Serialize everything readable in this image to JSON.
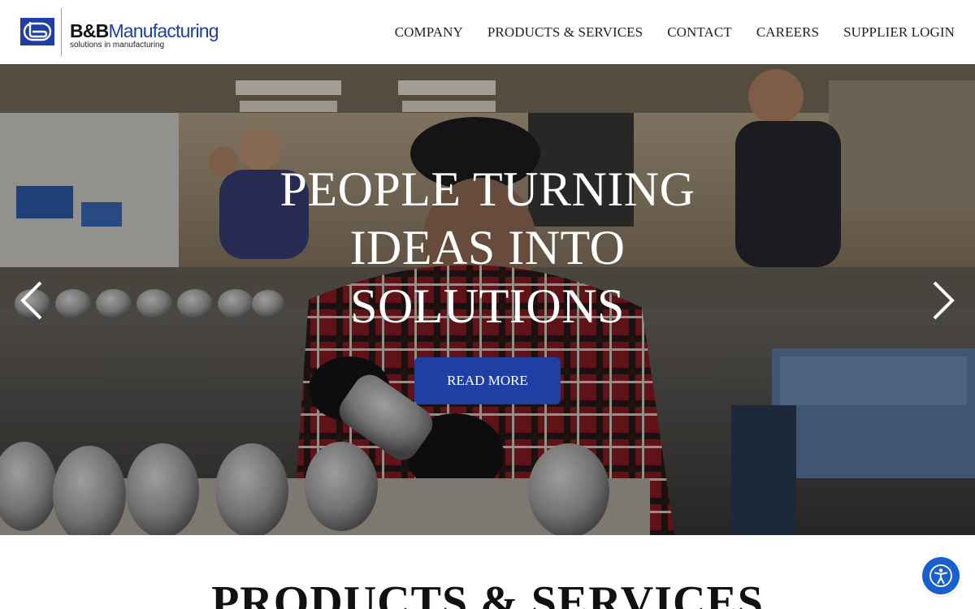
{
  "brand": {
    "name_bold": "B&B",
    "name_regular": "Manufacturing",
    "tagline": "solutions in manufacturing",
    "primary_color": "#1f3fa5"
  },
  "nav": {
    "items": [
      {
        "label": "COMPANY"
      },
      {
        "label": "PRODUCTS & SERVICES"
      },
      {
        "label": "CONTACT"
      },
      {
        "label": "CAREERS"
      },
      {
        "label": "SUPPLIER LOGIN"
      }
    ]
  },
  "hero": {
    "headline_lines": [
      "PEOPLE TURNING",
      "IDEAS INTO",
      "SOLUTIONS"
    ],
    "cta_label": "READ MORE",
    "cta_color": "#1f3fa5",
    "prev_icon": "chevron-left-icon",
    "next_icon": "chevron-right-icon"
  },
  "section": {
    "title": "PRODUCTS & SERVICES"
  },
  "accessibility": {
    "icon": "accessibility-icon",
    "color": "#1a5fd0"
  }
}
